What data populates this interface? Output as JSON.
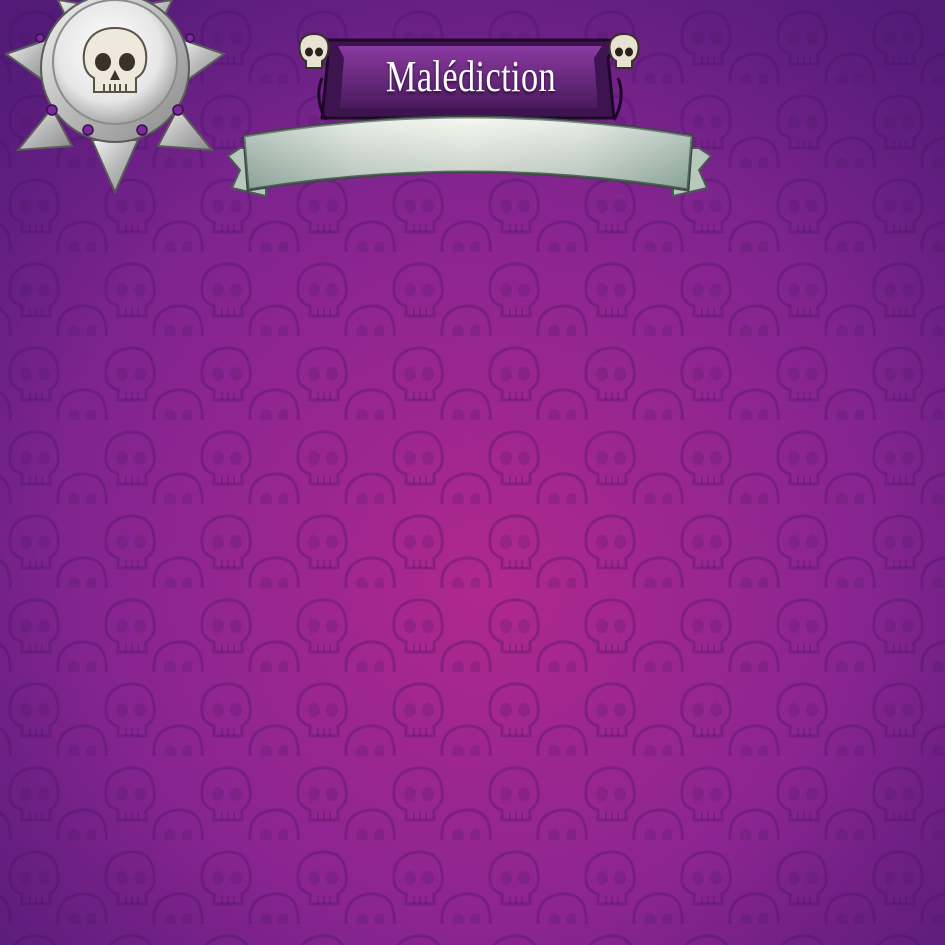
{
  "screen": {
    "title": "Malédiction",
    "icon": "skull-icon"
  },
  "colors": {
    "background_center": "#a8268f",
    "background_edge": "#6a1f8c",
    "banner_plate": "#6a2a7f",
    "ribbon": "#d9e4da",
    "badge_silver": "#d8d8d8"
  }
}
